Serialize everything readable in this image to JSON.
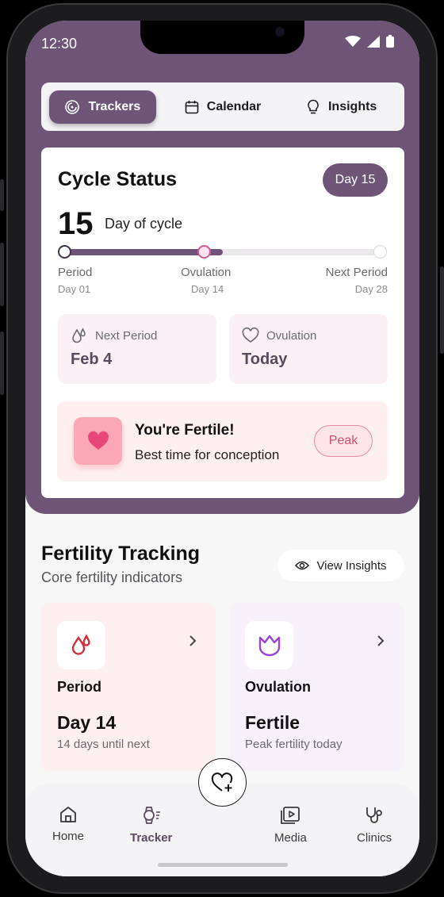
{
  "status_bar": {
    "time": "12:30"
  },
  "tabs": [
    {
      "label": "Trackers",
      "icon": "tracker-circle-icon",
      "active": true
    },
    {
      "label": "Calendar",
      "icon": "calendar-icon",
      "active": false
    },
    {
      "label": "Insights",
      "icon": "lightbulb-icon",
      "active": false
    }
  ],
  "cycle_status": {
    "title": "Cycle Status",
    "day_badge": "Day 15",
    "current_day": "15",
    "current_day_label": "Day of cycle",
    "progress_fraction": 0.5,
    "milestones": [
      {
        "label": "Period",
        "sub": "Day 01"
      },
      {
        "label": "Ovulation",
        "sub": "Day 14"
      },
      {
        "label": "Next Period",
        "sub": "Day 28"
      }
    ],
    "next_period": {
      "label": "Next Period",
      "value": "Feb 4",
      "icon": "droplets-icon"
    },
    "ovulation": {
      "label": "Ovulation",
      "value": "Today",
      "icon": "heart-outline-icon"
    },
    "fertile": {
      "title": "You're Fertile!",
      "subtitle": "Best time for conception",
      "badge": "Peak",
      "icon": "heart-icon"
    }
  },
  "fertility_tracking": {
    "title": "Fertility Tracking",
    "subtitle": "Core fertility indicators",
    "view_insights_label": "View Insights",
    "cards": [
      {
        "name": "Period",
        "value": "Day 14",
        "note": "14 days until next",
        "icon": "droplets-icon"
      },
      {
        "name": "Ovulation",
        "value": "Fertile",
        "note": "Peak fertility today",
        "icon": "flower-icon"
      }
    ]
  },
  "bottom_nav": [
    {
      "label": "Home",
      "icon": "home-icon",
      "active": false
    },
    {
      "label": "Tracker",
      "icon": "watch-icon",
      "active": true
    },
    {
      "label": "Media",
      "icon": "media-icon",
      "active": false
    },
    {
      "label": "Clinics",
      "icon": "stethoscope-icon",
      "active": false
    }
  ],
  "fab": {
    "icon": "heart-plus-icon"
  },
  "colors": {
    "brand_purple": "#6e5577",
    "fertile_pink": "#fba7b5",
    "peak_text": "#d04d6d",
    "period_red": "#d12f3a",
    "ovulation_purple": "#9b43d6"
  }
}
